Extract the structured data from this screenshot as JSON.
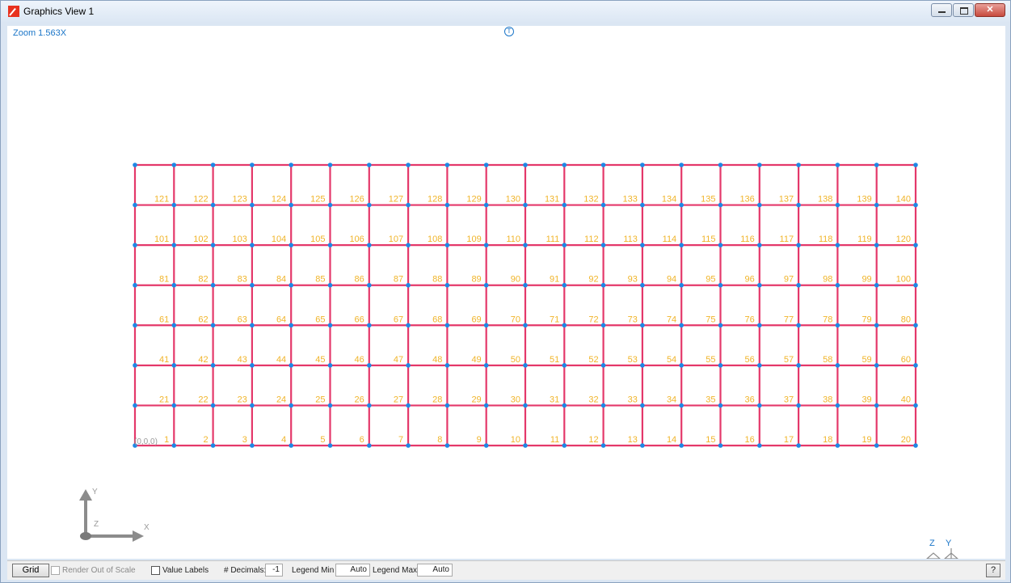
{
  "window": {
    "title": "Graphics View 1"
  },
  "view": {
    "zoom": "Zoom  1.563X",
    "origin_label": "(0,0,0)",
    "axis_labels": {
      "x": "X",
      "y": "Y",
      "z": "Z"
    },
    "corner_axis_labels": {
      "z": "Z",
      "y": "Y"
    }
  },
  "mesh": {
    "columns": 20,
    "rows": 7,
    "node_labels_start": 1,
    "colors": {
      "line": "#e4386a",
      "node": "#1e88e5",
      "label": "#f0b429"
    }
  },
  "toolbar": {
    "grid_label": "Grid",
    "render_out_of_scale": "Render Out of Scale",
    "value_labels": "Value Labels",
    "decimals_label": "# Decimals:",
    "decimals_value": "-1",
    "legend_min_label": "Legend Min",
    "legend_min_value": "Auto",
    "legend_max_label": "Legend Max",
    "legend_max_value": "Auto",
    "help_label": "?"
  }
}
